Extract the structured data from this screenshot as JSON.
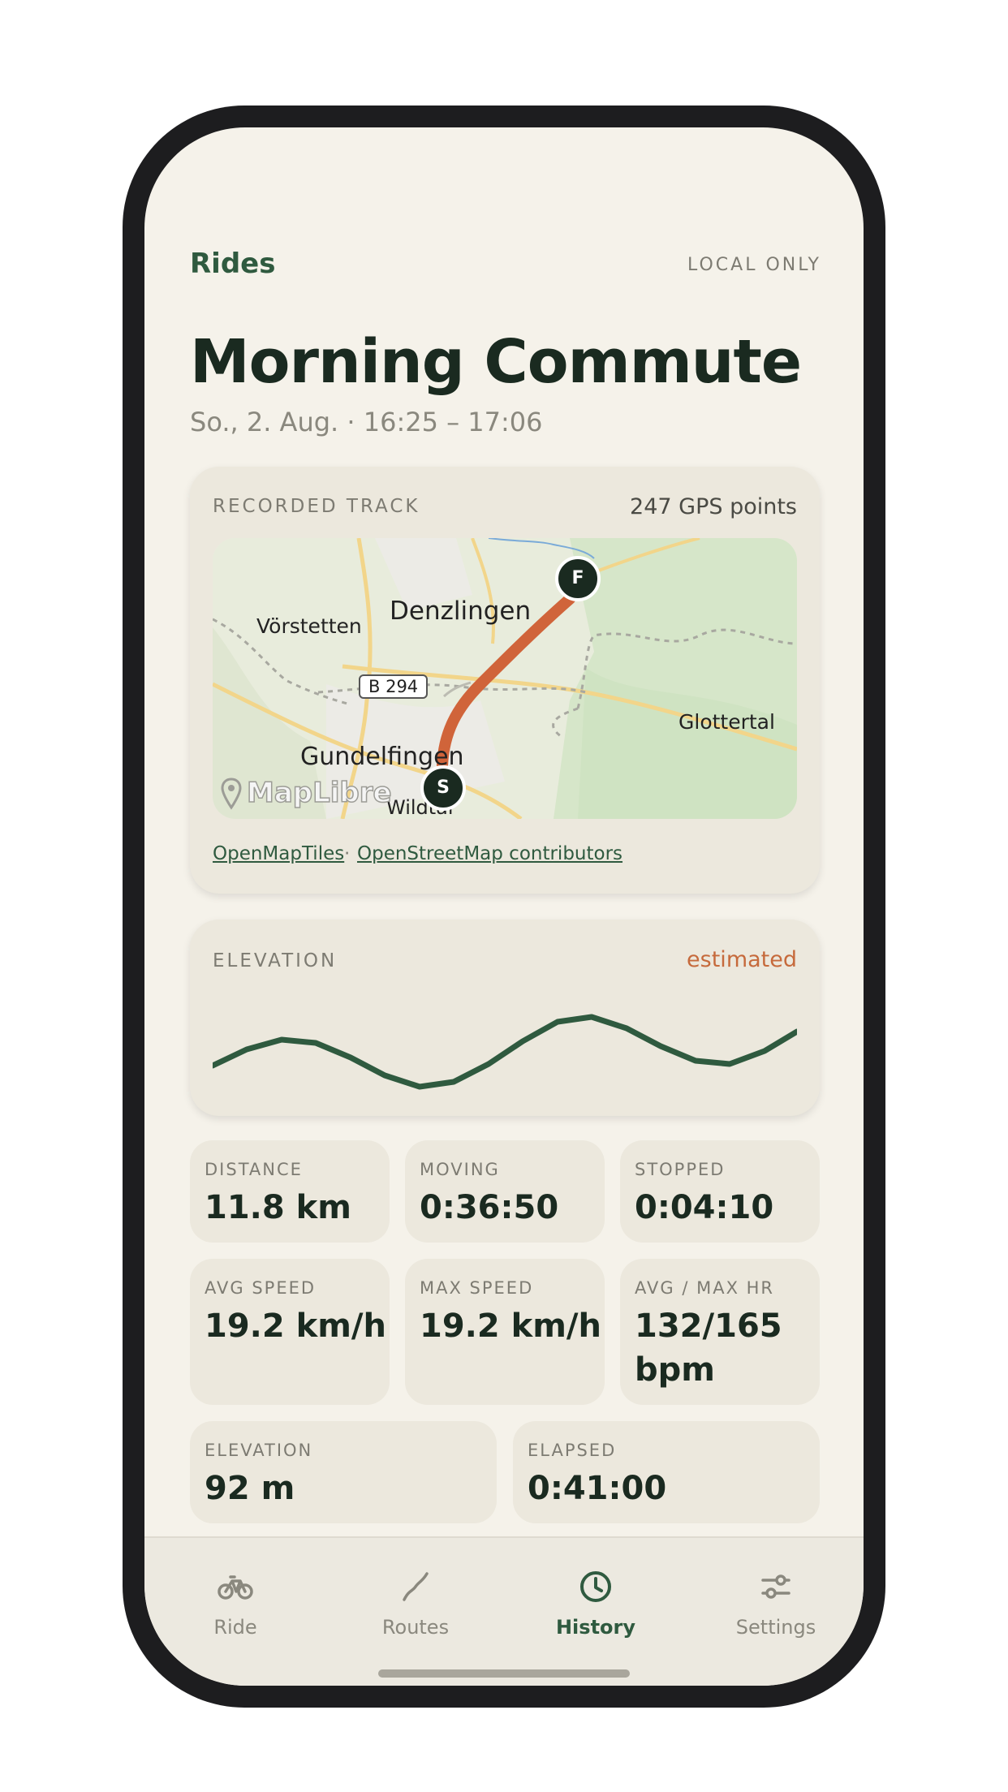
{
  "header": {
    "back_label": "Rides",
    "badge": "LOCAL ONLY"
  },
  "ride": {
    "title": "Morning Commute",
    "subtitle": "So., 2. Aug. · 16:25 – 17:06"
  },
  "track_card": {
    "label": "RECORDED TRACK",
    "points": "247 GPS points",
    "map": {
      "places": [
        "Vörstetten",
        "Denzlingen",
        "Glottertal",
        "Gundelfingen",
        "Wildtal"
      ],
      "road_label": "B 294",
      "watermark": "MapLibre",
      "start_marker": "S",
      "finish_marker": "F",
      "route_color": "#d0643a"
    },
    "attributions": [
      "OpenMapTiles",
      "OpenStreetMap contributors"
    ],
    "attribution_separator": "·"
  },
  "elevation_card": {
    "label": "ELEVATION",
    "badge": "estimated",
    "line_color": "#2f5a3f"
  },
  "stats": [
    {
      "label": "DISTANCE",
      "value": "11.8 km"
    },
    {
      "label": "MOVING",
      "value": "0:36:50"
    },
    {
      "label": "STOPPED",
      "value": "0:04:10"
    },
    {
      "label": "AVG SPEED",
      "value": "19.2 km/h"
    },
    {
      "label": "MAX SPEED",
      "value": "19.2 km/h"
    },
    {
      "label": "AVG / MAX HR",
      "value": "132/165 bpm"
    },
    {
      "label": "ELEVATION",
      "value": "92 m"
    },
    {
      "label": "ELAPSED",
      "value": "0:41:00"
    }
  ],
  "tabs": [
    {
      "label": "Ride",
      "icon": "bicycle-icon",
      "active": false
    },
    {
      "label": "Routes",
      "icon": "route-icon",
      "active": false
    },
    {
      "label": "History",
      "icon": "clock-icon",
      "active": true
    },
    {
      "label": "Settings",
      "icon": "sliders-icon",
      "active": false
    }
  ],
  "colors": {
    "accent": "#2f5a3f",
    "route": "#d0643a",
    "estimated": "#c66a3c",
    "background": "#f5f2ea",
    "card": "#ece8dd"
  }
}
